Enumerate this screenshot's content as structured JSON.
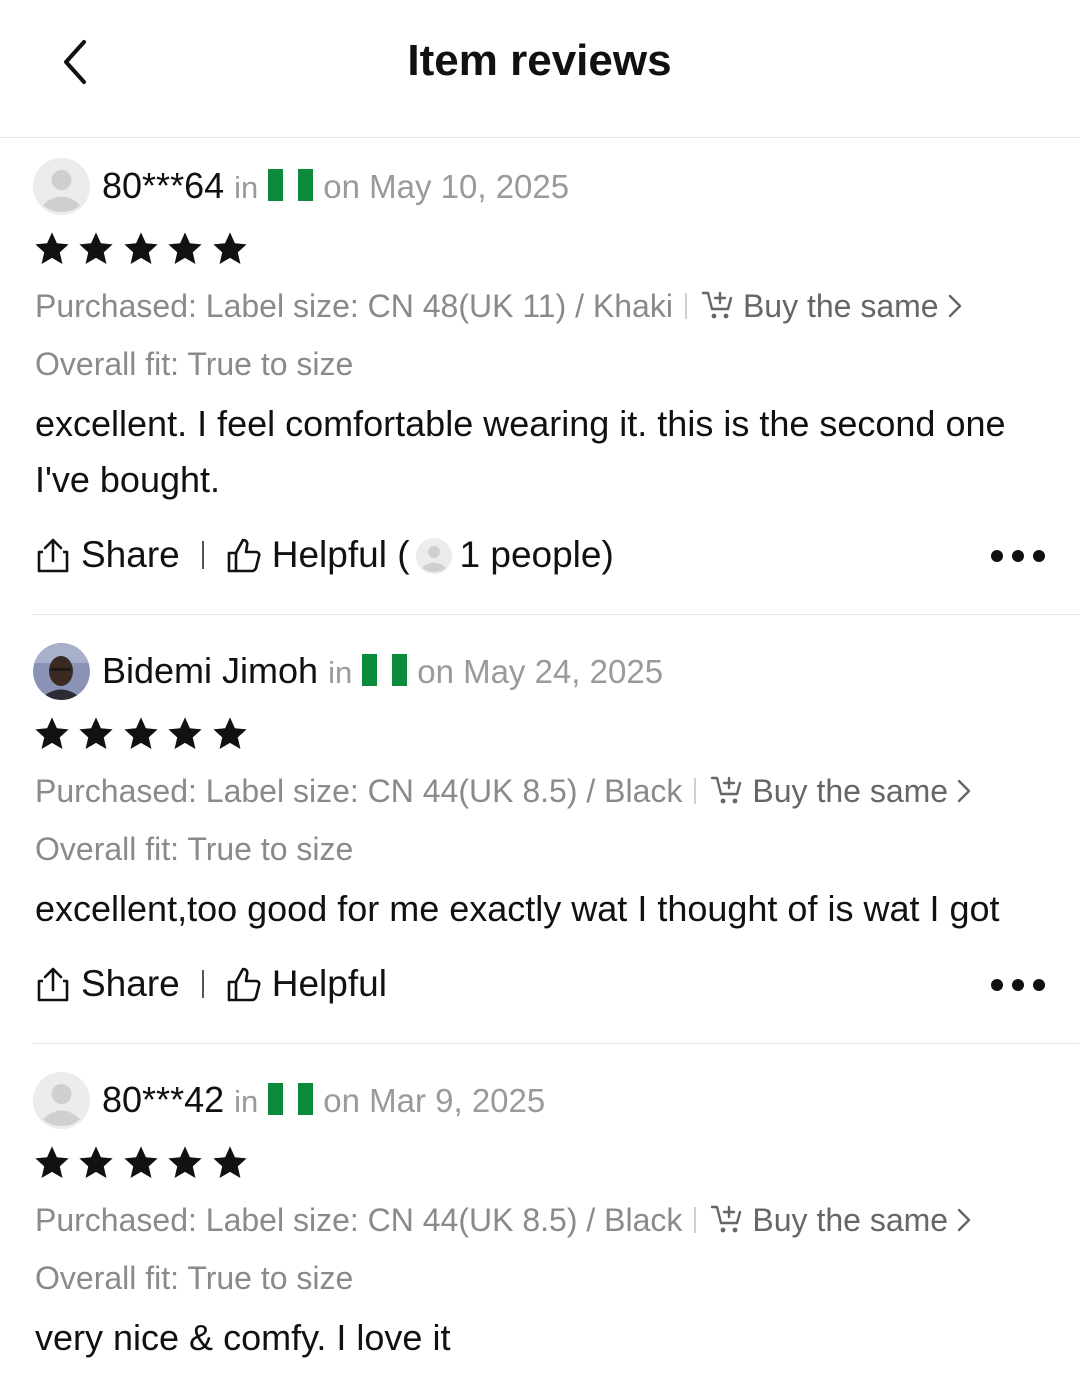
{
  "header": {
    "title": "Item reviews"
  },
  "reviews": [
    {
      "username": "80***64",
      "in_label": "in",
      "country_flag": "nigeria-flag",
      "date": "on May 10, 2025",
      "rating": 5,
      "purchased": "Purchased: Label size: CN 48(UK 11) / Khaki",
      "buy_same": "Buy the same",
      "fit": "Overall fit: True to size",
      "content": "excellent. I feel comfortable wearing it. this is the second one I've bought.",
      "share": "Share",
      "helpful": "Helpful (",
      "helpful_count": "1 people)",
      "avatar": "default-avatar"
    },
    {
      "username": "Bidemi Jimoh",
      "in_label": "in",
      "country_flag": "nigeria-flag",
      "date": "on May 24, 2025",
      "rating": 5,
      "purchased": "Purchased: Label size: CN 44(UK 8.5) / Black",
      "buy_same": "Buy the same",
      "fit": "Overall fit: True to size",
      "content": "excellent,too good for me exactly wat I thought of is wat I got",
      "share": "Share",
      "helpful": "Helpful",
      "avatar": "user-photo-avatar"
    },
    {
      "username": "80***42",
      "in_label": "in",
      "country_flag": "nigeria-flag",
      "date": "on Mar 9, 2025",
      "rating": 5,
      "purchased": "Purchased: Label size: CN 44(UK 8.5) / Black",
      "buy_same": "Buy the same",
      "fit": "Overall fit: True to size",
      "content": "very nice & comfy. I love it",
      "avatar": "default-avatar"
    }
  ],
  "colors": {
    "text_primary": "#111111",
    "text_secondary": "#8a8a8a",
    "flag_green": "#0a8a3a"
  }
}
